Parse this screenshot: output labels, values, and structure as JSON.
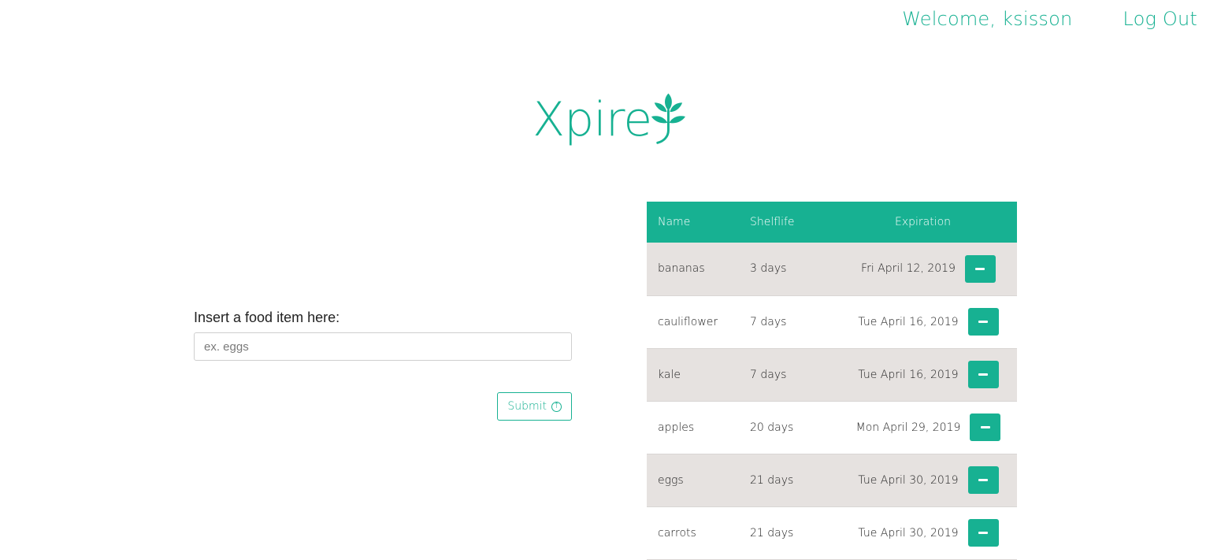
{
  "nav": {
    "welcome": "Welcome, ksisson",
    "logout": "Log Out"
  },
  "logo": {
    "text": "Xpire",
    "icon": "leaf-icon"
  },
  "form": {
    "label": "Insert a food item here:",
    "placeholder": "ex. eggs",
    "submit_label": "Submit",
    "submit_icon": "arrow-up-circle-icon"
  },
  "table": {
    "headers": [
      "Name",
      "Shelflife",
      "Expiration"
    ],
    "rows": [
      {
        "name": "bananas",
        "shelflife": "3 days",
        "expiration": "Fri April 12, 2019"
      },
      {
        "name": "cauliflower",
        "shelflife": "7 days",
        "expiration": "Tue April 16, 2019"
      },
      {
        "name": "kale",
        "shelflife": "7 days",
        "expiration": "Tue April 16, 2019"
      },
      {
        "name": "apples",
        "shelflife": "20 days",
        "expiration": "Mon April 29, 2019"
      },
      {
        "name": "eggs",
        "shelflife": "21 days",
        "expiration": "Tue April 30, 2019"
      },
      {
        "name": "carrots",
        "shelflife": "21 days",
        "expiration": "Tue April 30, 2019"
      }
    ]
  },
  "colors": {
    "accent": "#17b192",
    "row_alt": "#e6e2e0"
  }
}
